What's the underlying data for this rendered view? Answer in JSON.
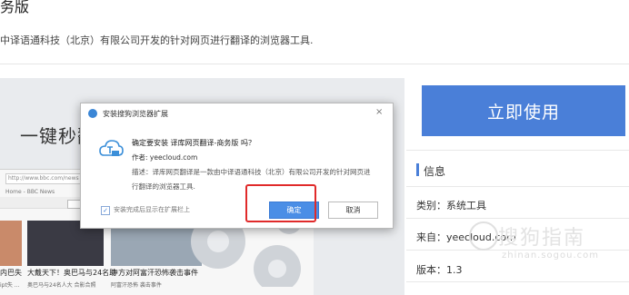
{
  "header": {
    "title": "务版",
    "description": "中译语通科技（北京）有限公司开发的针对网页进行翻译的浏览器工具."
  },
  "preview": {
    "headline": "一键秒翻",
    "address": "http://www.bbc.com/news",
    "breadcrumb": "Home - BBC News",
    "news": [
      {
        "caption": "内巴失",
        "sub": "ipt失 ..."
      },
      {
        "caption": "大戴天下！奥巴马与24名助",
        "sub": "奥巴马与24名人大 合影合照"
      },
      {
        "caption": "中方对阿富汗恐怖袭击事件",
        "sub": "阿富汗恐怖 袭击事件"
      }
    ]
  },
  "dialog": {
    "title": "安装搜狗浏览器扩展",
    "close": "×",
    "question": "确定要安装 译库网页翻译-商务版 吗？",
    "author": "作者: yeecloud.com",
    "description": "描述：译库网页翻译是一款由中译语通科技（北京）有限公司开发的针对网页进行翻译的浏览器工具.",
    "checkbox_label": "安装完成后显示在扩展栏上",
    "checkbox_mark": "✓",
    "ok": "确定",
    "cancel": "取消"
  },
  "sidebar": {
    "cta": "立即使用",
    "info_title": "信息",
    "rows": [
      "类别：系统工具",
      "来自：yeecloud.com",
      "版本：1.3"
    ]
  },
  "watermark": {
    "text": "搜狗指南",
    "url": "zhinan.sogou.com"
  },
  "colors": {
    "accent": "#4a7fd8",
    "highlight": "#e02a2a"
  }
}
